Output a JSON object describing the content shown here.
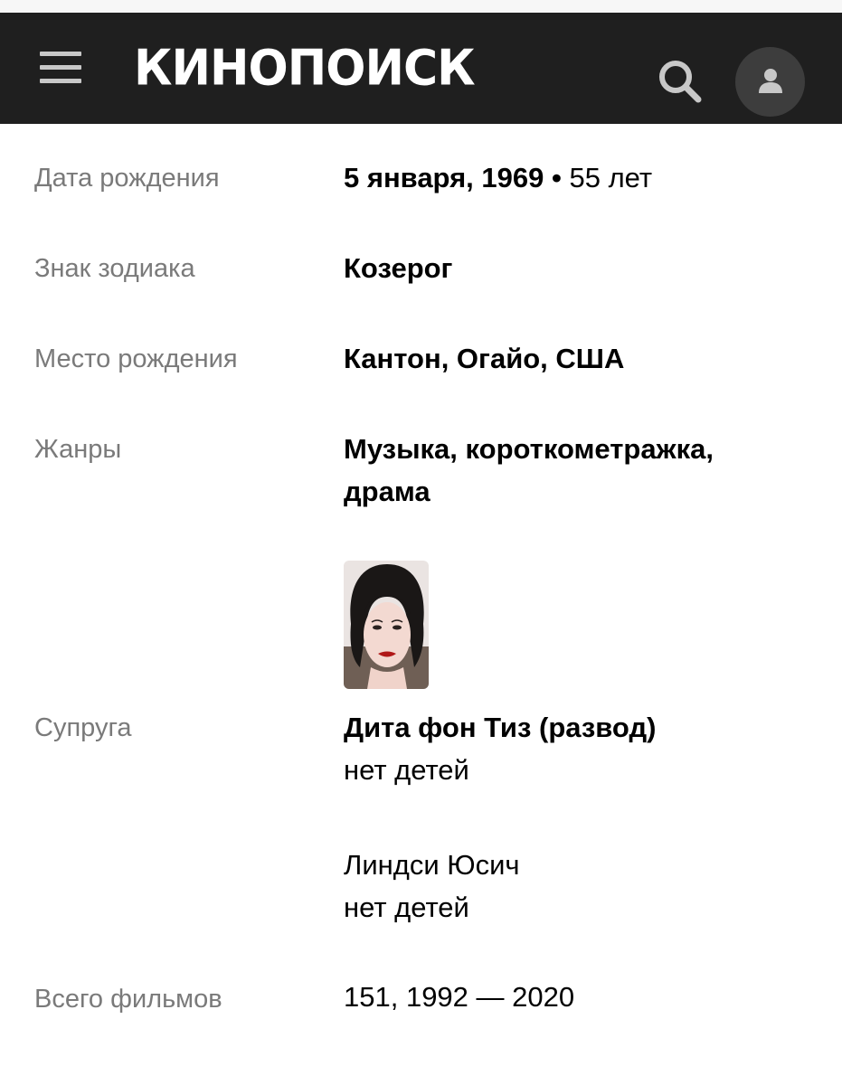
{
  "header": {
    "logo_text": "КИНОПОИСК",
    "menu_icon": "hamburger-menu-icon",
    "search_icon": "search-icon",
    "profile_icon": "user-icon",
    "background": "#1f1f1f"
  },
  "details": {
    "birth_date": {
      "label": "Дата рождения",
      "date": "5 января, 1969",
      "separator": "•",
      "age": "55 лет"
    },
    "zodiac": {
      "label": "Знак зодиака",
      "value": "Козерог"
    },
    "birthplace": {
      "label": "Место рождения",
      "value": "Кантон, Огайо, США"
    },
    "genres": {
      "label": "Жанры",
      "line1": "Музыка, короткометражка,",
      "line2": "драма"
    },
    "spouse": {
      "label": "Супруга",
      "first": {
        "name": "Дита фон Тиз (развод)",
        "children": "нет детей"
      },
      "second": {
        "name": "Линдси Юсич",
        "children": "нет детей"
      }
    },
    "films": {
      "label": "Всего фильмов",
      "value": "151, 1992 — 2020"
    }
  },
  "colors": {
    "label": "#7a7a7a",
    "value": "#000000"
  }
}
